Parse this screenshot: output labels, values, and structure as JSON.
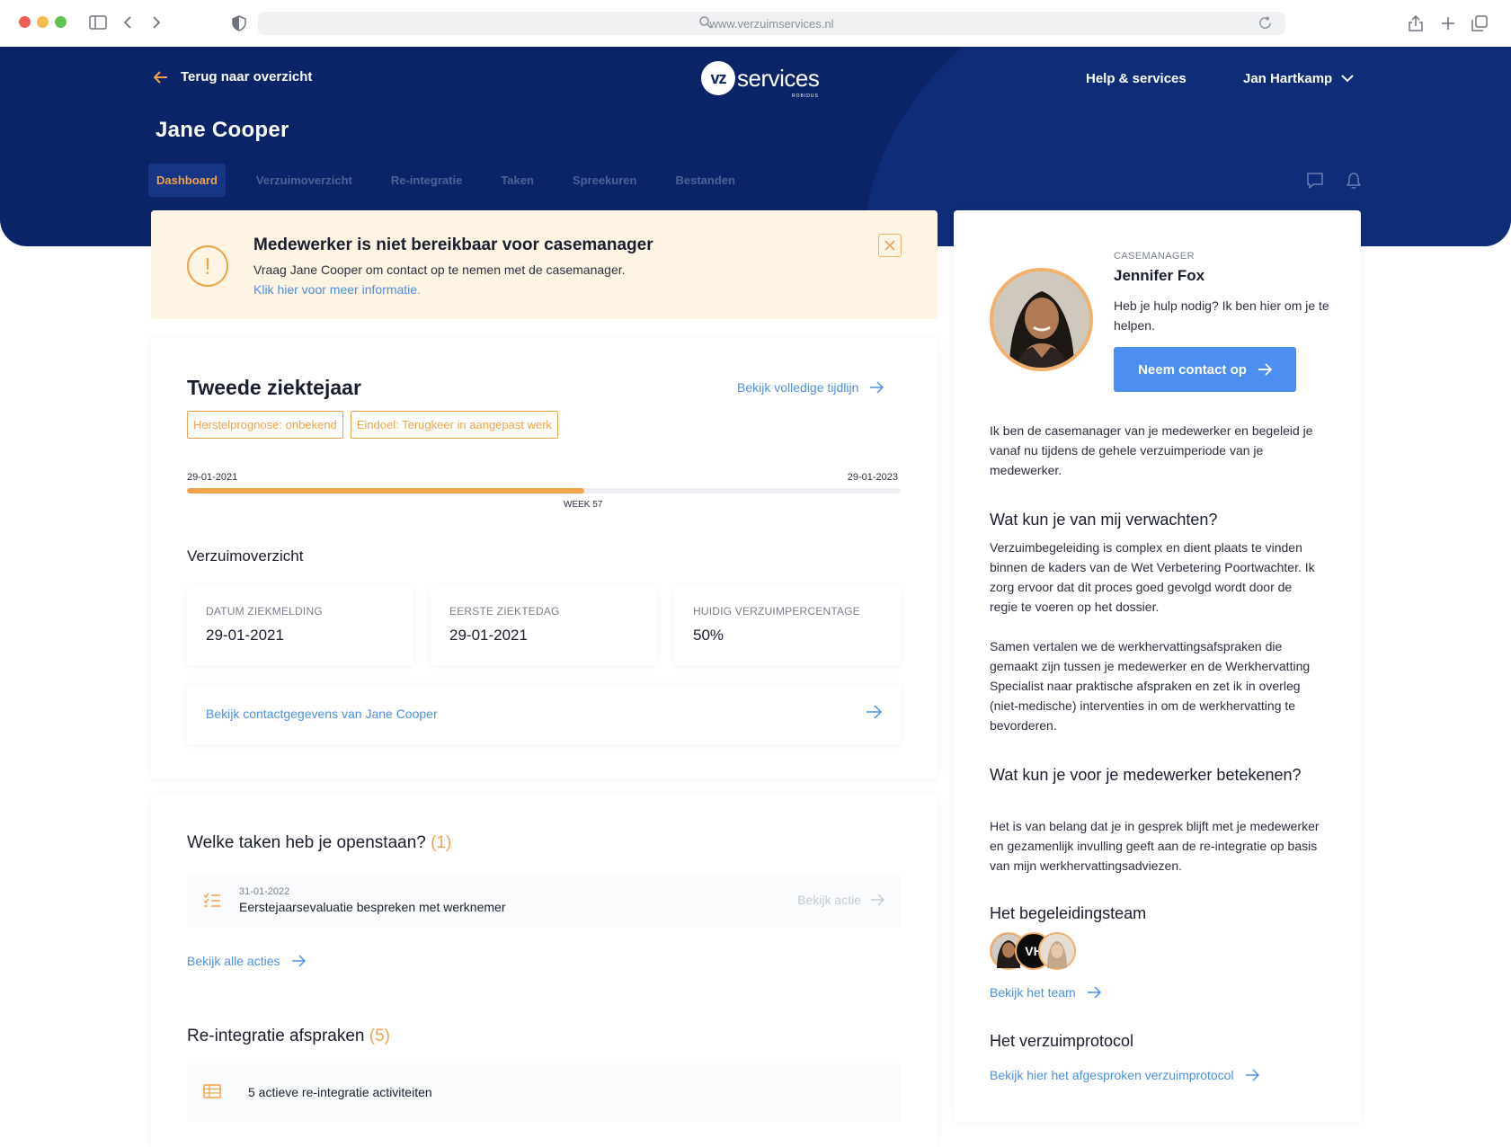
{
  "browser": {
    "url": "www.verzuimservices.nl"
  },
  "header": {
    "back_label": "Terug naar overzicht",
    "logo_mark": "vz",
    "logo_text": "services",
    "logo_sub": "ROBIDUS",
    "help_label": "Help & services",
    "user_name": "Jan Hartkamp",
    "page_title": "Jane Cooper",
    "tabs": [
      {
        "label": "Dashboard",
        "active": true
      },
      {
        "label": "Verzuimoverzicht",
        "active": false
      },
      {
        "label": "Re-integratie",
        "active": false
      },
      {
        "label": "Taken",
        "active": false
      },
      {
        "label": "Spreekuren",
        "active": false
      },
      {
        "label": "Bestanden",
        "active": false
      }
    ]
  },
  "alert": {
    "icon_symbol": "!",
    "title": "Medewerker is niet bereikbaar voor casemanager",
    "text": "Vraag Jane Cooper om contact op te nemen met de casemanager.",
    "link": "Klik hier voor meer informatie."
  },
  "overview": {
    "title": "Tweede ziektejaar",
    "timeline_link": "Bekijk volledige tijdlijn",
    "tags": [
      "Herstelprognose: onbekend",
      "Eindoel: Terugkeer in aangepast werk"
    ],
    "start_date": "29-01-2021",
    "end_date": "29-01-2023",
    "progress_fraction": 0.557,
    "week_label": "WEEK 57",
    "subtitle": "Verzuimoverzicht",
    "stats": [
      {
        "label": "DATUM ZIEKMELDING",
        "value": "29-01-2021"
      },
      {
        "label": "EERSTE ZIEKTEDAG",
        "value": "29-01-2021"
      },
      {
        "label": "HUIDIG VERZUIMPERCENTAGE",
        "value": "50%"
      }
    ],
    "contact_link": "Bekijk contactgegevens van Jane Cooper"
  },
  "tasks": {
    "title": "Welke taken heb je openstaan?",
    "count": "(1)",
    "items": [
      {
        "date": "31-01-2022",
        "text": "Eerstejaarsevaluatie bespreken met werknemer",
        "action": "Bekijk actie"
      }
    ],
    "all_link": "Bekijk alle acties",
    "reintegration_title": "Re-integratie afspraken",
    "reintegration_count": "(5)",
    "reintegration_text": "5 actieve re-integratie activiteiten"
  },
  "casemanager": {
    "label": "CASEMANAGER",
    "name": "Jennifer Fox",
    "help_text": "Heb je hulp nodig? Ik ben hier om je te helpen.",
    "button": "Neem contact op",
    "intro": "Ik ben de casemanager van je medewerker en begeleid je vanaf nu tijdens de gehele verzuimperiode van je medewerker.",
    "section1_title": "Wat kun je van mij verwachten?",
    "section1_p1": "Verzuimbegeleiding is complex en dient plaats te vinden binnen de kaders van de Wet Verbetering Poortwachter. Ik zorg ervoor dat dit proces goed gevolgd wordt door de regie te voeren op het dossier.",
    "section1_p2": "Samen vertalen we de werkhervattingsafspraken die gemaakt zijn tussen je medewerker en de Werkhervatting Specialist naar praktische afspraken en zet ik in overleg (niet-medische) interventies in om de werkhervatting te bevorderen.",
    "section2_title": "Wat kun je voor je medewerker betekenen?",
    "section2_p": "Het is van belang dat je in gesprek blijft met je medewerker en gezamenlijk invulling geeft aan de re-integratie op basis van mijn werkhervattingsadviezen.",
    "team_title": "Het begeleidingsteam",
    "team_initials": "VH",
    "team_link": "Bekijk het team",
    "protocol_title": "Het verzuimprotocol",
    "protocol_link": "Bekijk hier het afgesproken verzuimprotocol"
  },
  "colors": {
    "navy": "#0b2467",
    "accent_orange": "#f3a34a",
    "link_blue": "#4d8fe0",
    "button_blue": "#4c8ff0",
    "alert_bg": "#fdf4e4"
  }
}
